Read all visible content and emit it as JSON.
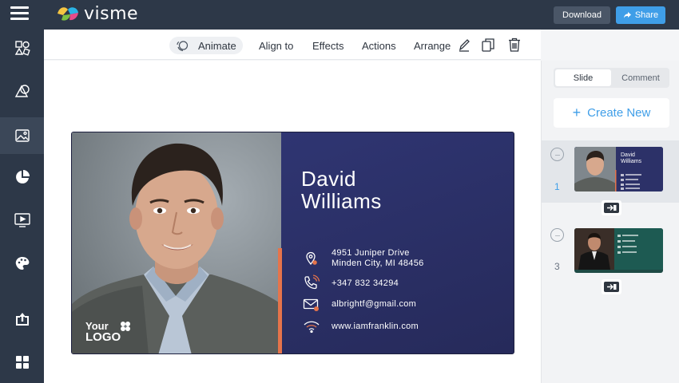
{
  "app": {
    "logo_text": "visme"
  },
  "topbar": {
    "download_label": "Download",
    "share_label": "Share"
  },
  "sidebar": {
    "items": [
      {
        "icon": "elements-icon"
      },
      {
        "icon": "shapes-icon"
      },
      {
        "icon": "image-icon",
        "active": true
      },
      {
        "icon": "chart-icon"
      },
      {
        "icon": "media-icon"
      },
      {
        "icon": "palette-icon"
      },
      {
        "icon": "upload-icon"
      },
      {
        "icon": "apps-icon"
      }
    ]
  },
  "toolbar": {
    "animate_label": "Animate",
    "align_label": "Align to",
    "effects_label": "Effects",
    "actions_label": "Actions",
    "arrange_label": "Arrange"
  },
  "card": {
    "first_name": "David",
    "last_name": "Williams",
    "address_line1": "4951 Juniper Drive",
    "address_line2": "Minden City, MI 48456",
    "phone": "+347 832 34294",
    "email": "albrightf@gmail.com",
    "website": "www.iamfranklin.com",
    "logo_line1": "Your",
    "logo_line2": "LOGO",
    "accent_color": "#e5744b",
    "background_color": "#2a2f63"
  },
  "right_panel": {
    "tab_slide": "Slide",
    "tab_comment": "Comment",
    "create_new_label": "Create New",
    "slides": [
      {
        "number": "1",
        "selected": true,
        "thumb_name": "David",
        "thumb_name2": "Williams"
      },
      {
        "number": "3",
        "selected": false
      }
    ],
    "dots_glyph": "···",
    "plus_glyph": "+"
  },
  "colors": {
    "topbar": "#2d3848",
    "brand_blue": "#3f9ee8"
  }
}
